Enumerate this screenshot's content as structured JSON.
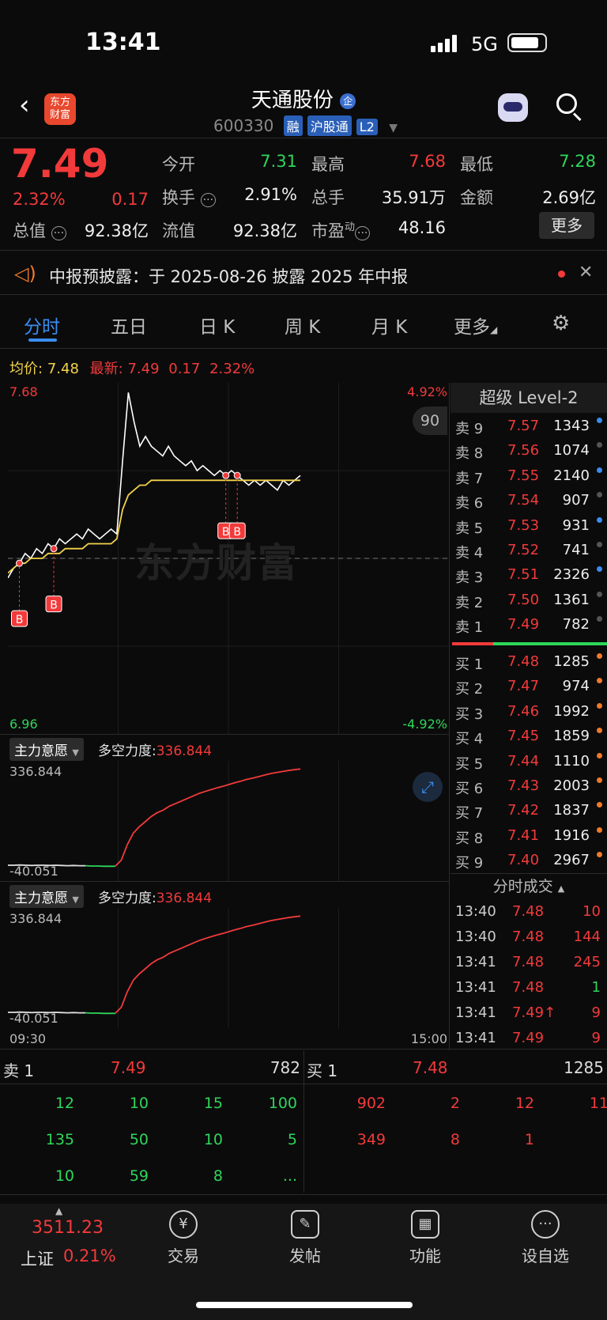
{
  "status_bar": {
    "time": "13:41",
    "network": "5G"
  },
  "header": {
    "logo_line1": "东方",
    "logo_line2": "财富",
    "stock_name": "天通股份",
    "name_badge": "企",
    "code": "600330",
    "tags": [
      "融",
      "沪股通",
      "L2"
    ]
  },
  "quote": {
    "price": "7.49",
    "change_pct": "2.32%",
    "change": "0.17",
    "today_open_label": "今开",
    "today_open": "7.31",
    "high_label": "最高",
    "high": "7.68",
    "low_label": "最低",
    "low": "7.28",
    "turnover_label": "换手",
    "turnover": "2.91%",
    "volume_label": "总手",
    "volume": "35.91万",
    "amount_label": "金额",
    "amount": "2.69亿",
    "mktcap_label": "总值",
    "mktcap": "92.38亿",
    "float_label": "流值",
    "float": "92.38亿",
    "pe_label": "市盈",
    "pe_sup": "动",
    "pe": "48.16",
    "more_button": "更多"
  },
  "notice": {
    "text": "中报预披露：于 2025-08-26 披露 2025 年中报"
  },
  "tabs": [
    {
      "label": "分时",
      "active": true
    },
    {
      "label": "五日"
    },
    {
      "label": "日 K"
    },
    {
      "label": "周 K"
    },
    {
      "label": "月 K"
    },
    {
      "label": "更多"
    }
  ],
  "chart_legend": {
    "avg_label": "均价:",
    "avg_value": "7.48",
    "latest_label": "最新:",
    "latest_value": "7.49",
    "latest_change": "0.17",
    "latest_pct": "2.32%"
  },
  "chart_data": {
    "type": "line",
    "y_max_label": "7.68",
    "y_min_label": "6.96",
    "pct_max_label": "4.92%",
    "pct_min_label": "-4.92%",
    "x_start": "09:30",
    "x_end": "15:00",
    "prev_close": 7.32,
    "watermark": "东方财富",
    "float_badge": "90",
    "series": [
      {
        "name": "price",
        "color": "#ffffff",
        "values": [
          7.28,
          7.3,
          7.31,
          7.33,
          7.32,
          7.34,
          7.33,
          7.35,
          7.34,
          7.36,
          7.35,
          7.36,
          7.37,
          7.36,
          7.38,
          7.37,
          7.36,
          7.37,
          7.38,
          7.37,
          7.52,
          7.66,
          7.6,
          7.55,
          7.57,
          7.55,
          7.54,
          7.53,
          7.55,
          7.53,
          7.52,
          7.51,
          7.52,
          7.5,
          7.51,
          7.5,
          7.49,
          7.5,
          7.49,
          7.5,
          7.49,
          7.48,
          7.47,
          7.48,
          7.47,
          7.48,
          7.47,
          7.46,
          7.48,
          7.47,
          7.48,
          7.49
        ]
      },
      {
        "name": "avg",
        "color": "#f3d34a",
        "values": [
          7.29,
          7.3,
          7.31,
          7.31,
          7.32,
          7.32,
          7.32,
          7.33,
          7.33,
          7.33,
          7.34,
          7.34,
          7.34,
          7.34,
          7.35,
          7.35,
          7.35,
          7.35,
          7.35,
          7.36,
          7.42,
          7.45,
          7.46,
          7.47,
          7.47,
          7.48,
          7.48,
          7.48,
          7.48,
          7.48,
          7.48,
          7.48,
          7.48,
          7.48,
          7.48,
          7.48,
          7.48,
          7.48,
          7.48,
          7.48,
          7.48,
          7.48,
          7.48,
          7.48,
          7.48,
          7.48,
          7.48,
          7.48,
          7.48,
          7.48,
          7.48,
          7.48
        ]
      }
    ],
    "markers": [
      {
        "label": "B",
        "index": 2
      },
      {
        "label": "B",
        "index": 8
      },
      {
        "label": "B",
        "index": 38
      },
      {
        "label": "B",
        "index": 40
      }
    ]
  },
  "indicators": [
    {
      "name": "主力意愿",
      "metric_label": "多空力度:",
      "metric_value": "336.844",
      "top": "336.844",
      "bottom": "-40.051"
    },
    {
      "name": "主力意愿",
      "metric_label": "多空力度:",
      "metric_value": "336.844",
      "top": "336.844",
      "bottom": "-40.051"
    }
  ],
  "indicator_data": {
    "values": [
      -40,
      -40,
      -39,
      -40,
      -41,
      -40,
      -40,
      -41,
      -40,
      -41,
      -42,
      -41,
      -42,
      -42,
      -43,
      -43,
      -44,
      -44,
      -44,
      -20,
      40,
      85,
      110,
      130,
      150,
      165,
      175,
      190,
      200,
      210,
      220,
      230,
      240,
      248,
      255,
      262,
      268,
      275,
      282,
      288,
      295,
      300,
      306,
      312,
      318,
      322,
      326,
      330,
      333,
      336
    ]
  },
  "orderbook": {
    "title": "超级 Level-2",
    "asks": [
      {
        "label": "卖 9",
        "price": "7.57",
        "vol": "1343",
        "dot": "#3b8df0"
      },
      {
        "label": "卖 8",
        "price": "7.56",
        "vol": "1074",
        "dot": "#555555"
      },
      {
        "label": "卖 7",
        "price": "7.55",
        "vol": "2140",
        "dot": "#3b8df0"
      },
      {
        "label": "卖 6",
        "price": "7.54",
        "vol": "907",
        "dot": "#555555"
      },
      {
        "label": "卖 5",
        "price": "7.53",
        "vol": "931",
        "dot": "#3b8df0"
      },
      {
        "label": "卖 4",
        "price": "7.52",
        "vol": "741",
        "dot": "#555555"
      },
      {
        "label": "卖 3",
        "price": "7.51",
        "vol": "2326",
        "dot": "#3b8df0"
      },
      {
        "label": "卖 2",
        "price": "7.50",
        "vol": "1361",
        "dot": "#555555"
      },
      {
        "label": "卖 1",
        "price": "7.49",
        "vol": "782",
        "dot": "#555555"
      }
    ],
    "bids": [
      {
        "label": "买 1",
        "price": "7.48",
        "vol": "1285",
        "dot": "#f07a2a"
      },
      {
        "label": "买 2",
        "price": "7.47",
        "vol": "974",
        "dot": "#f07a2a"
      },
      {
        "label": "买 3",
        "price": "7.46",
        "vol": "1992",
        "dot": "#f07a2a"
      },
      {
        "label": "买 4",
        "price": "7.45",
        "vol": "1859",
        "dot": "#f07a2a"
      },
      {
        "label": "买 5",
        "price": "7.44",
        "vol": "1110",
        "dot": "#f07a2a"
      },
      {
        "label": "买 6",
        "price": "7.43",
        "vol": "2003",
        "dot": "#f07a2a"
      },
      {
        "label": "买 7",
        "price": "7.42",
        "vol": "1837",
        "dot": "#f07a2a"
      },
      {
        "label": "买 8",
        "price": "7.41",
        "vol": "1916",
        "dot": "#f07a2a"
      },
      {
        "label": "买 9",
        "price": "7.40",
        "vol": "2967",
        "dot": "#f07a2a"
      }
    ]
  },
  "trades": {
    "title": "分时成交",
    "rows": [
      {
        "time": "13:40",
        "price": "7.48",
        "vol": "10",
        "color": "red"
      },
      {
        "time": "13:40",
        "price": "7.48",
        "vol": "144",
        "color": "red"
      },
      {
        "time": "13:41",
        "price": "7.48",
        "vol": "245",
        "color": "red"
      },
      {
        "time": "13:41",
        "price": "7.48",
        "vol": "1",
        "color": "green"
      },
      {
        "time": "13:41",
        "price": "7.49↑",
        "vol": "9",
        "color": "red"
      },
      {
        "time": "13:41",
        "price": "7.49",
        "vol": "9",
        "color": "red"
      }
    ]
  },
  "queue": {
    "ask_label": "卖 1",
    "ask_price": "7.49",
    "ask_total": "782",
    "bid_label": "买 1",
    "bid_price": "7.48",
    "bid_total": "1285",
    "ask_orders": [
      [
        "12",
        "10",
        "15",
        "100"
      ],
      [
        "135",
        "50",
        "10",
        "5"
      ],
      [
        "10",
        "59",
        "8",
        "..."
      ]
    ],
    "bid_orders": [
      [
        "902",
        "2",
        "12",
        "11"
      ],
      [
        "349",
        "8",
        "1",
        ""
      ]
    ]
  },
  "bottom_nav": {
    "index_value": "3511.23",
    "index_name": "上证",
    "index_pct": "0.21%",
    "items": [
      "交易",
      "发帖",
      "功能",
      "设自选"
    ]
  }
}
